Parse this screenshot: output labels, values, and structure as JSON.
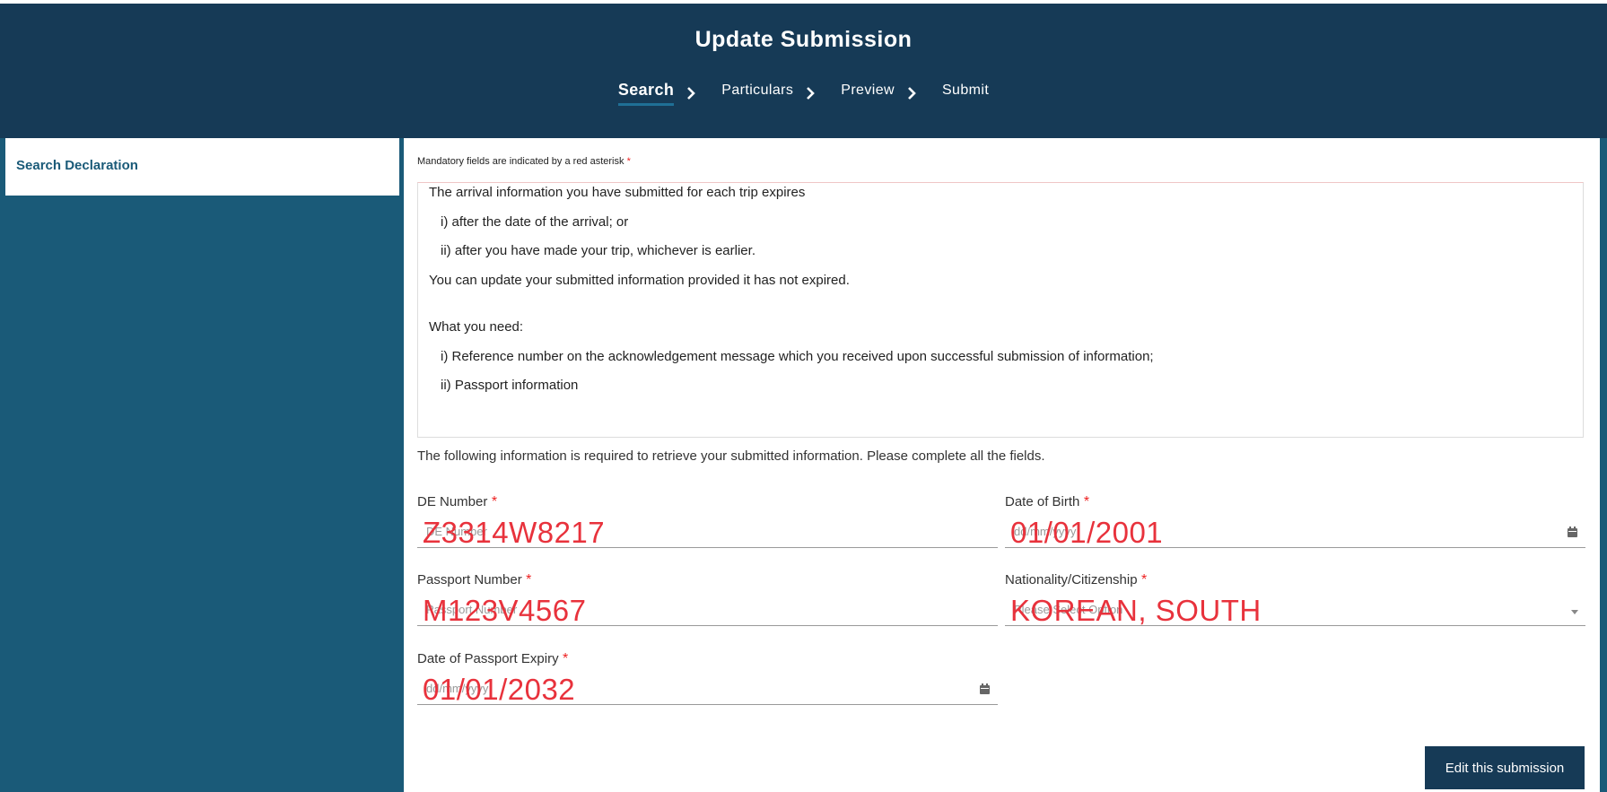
{
  "header": {
    "title": "Update Submission",
    "steps": [
      {
        "label": "Search",
        "active": true
      },
      {
        "label": "Particulars",
        "active": false
      },
      {
        "label": "Preview",
        "active": false
      },
      {
        "label": "Submit",
        "active": false
      }
    ]
  },
  "sidebar": {
    "items": [
      {
        "label": "Search Declaration"
      }
    ]
  },
  "main": {
    "mandatory_note": "Mandatory fields are indicated by a red asterisk",
    "required_marker": "*",
    "info": {
      "line1": "The arrival information you have submitted for each trip expires",
      "line2": "i) after the date of the arrival; or",
      "line3": "ii) after you have made your trip, whichever is earlier.",
      "line4": "You can update your submitted information provided it has not expired.",
      "line5": "What you need:",
      "line6": "i) Reference number on the acknowledgement message which you received upon successful submission of information;",
      "line7": "ii) Passport information"
    },
    "following": "The following information is required to retrieve your submitted information. Please complete all the fields.",
    "fields": {
      "de_number": {
        "label": "DE Number",
        "placeholder": "DE Number",
        "value": "Z3314W8217"
      },
      "dob": {
        "label": "Date of Birth",
        "placeholder": "dd/mm/yyyy",
        "value": "01/01/2001"
      },
      "passport": {
        "label": "Passport Number",
        "placeholder": "Passport Number",
        "value": "M123V4567"
      },
      "nationality": {
        "label": "Nationality/Citizenship",
        "placeholder": "Please Select Option",
        "value": "KOREAN, SOUTH"
      },
      "passport_expiry": {
        "label": "Date of Passport Expiry",
        "placeholder": "dd/mm/yyyy",
        "value": "01/01/2032"
      }
    },
    "edit_button": "Edit this submission"
  },
  "colors": {
    "header_bg": "#163a56",
    "sidebar_bg": "#1a5a78",
    "required": "#e22222",
    "overlay_text": "#e8323c"
  },
  "icons": [
    "chevron-right-icon",
    "calendar-icon",
    "caret-down-icon"
  ]
}
